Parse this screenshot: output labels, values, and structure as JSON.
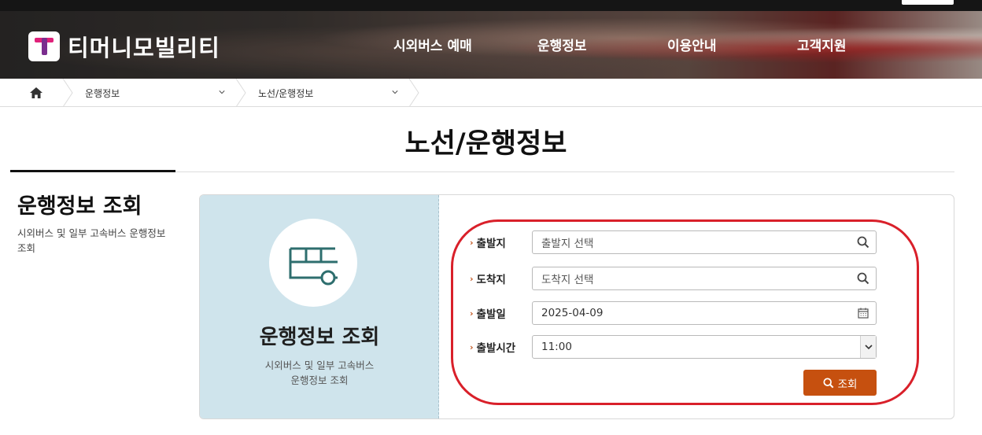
{
  "brand": {
    "name": "티머니모빌리티"
  },
  "nav": {
    "items": [
      {
        "label": "시외버스 예매"
      },
      {
        "label": "운행정보"
      },
      {
        "label": "이용안내"
      },
      {
        "label": "고객지원"
      }
    ]
  },
  "breadcrumb": {
    "home_icon": "home-icon",
    "items": [
      {
        "label": "운행정보"
      },
      {
        "label": "노선/운행정보"
      }
    ]
  },
  "page": {
    "title": "노선/운행정보"
  },
  "aside": {
    "title": "운행정보 조회",
    "description": "시외버스 및 일부 고속버스 운행정보 조회"
  },
  "panel": {
    "icon": "bus-icon",
    "title": "운행정보 조회",
    "description_line1": "시외버스 및 일부 고속버스",
    "description_line2": "운행정보 조회"
  },
  "form": {
    "departure": {
      "label": "출발지",
      "placeholder": "출발지 선택",
      "icon": "search-icon"
    },
    "arrival": {
      "label": "도착지",
      "placeholder": "도착지 선택",
      "icon": "search-icon"
    },
    "date": {
      "label": "출발일",
      "value": "2025-04-09",
      "icon": "calendar-icon"
    },
    "time": {
      "label": "출발시간",
      "value": "11:00",
      "icon": "chevron-down-icon"
    },
    "submit": {
      "label": "조회",
      "icon": "search-icon"
    }
  },
  "colors": {
    "accent": "#c6500f",
    "panel_bg": "#cfe4ec",
    "highlight": "#d9202a",
    "logo_pink": "#e0217a",
    "logo_purple": "#7b2d8e"
  }
}
